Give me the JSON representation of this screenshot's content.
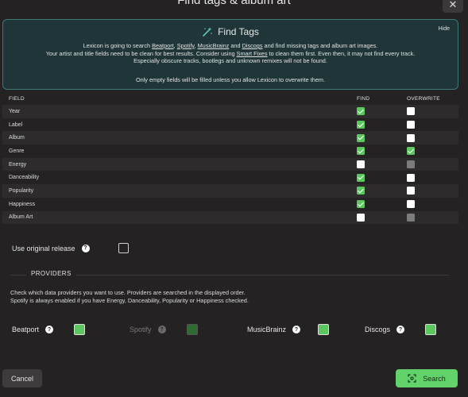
{
  "dialog": {
    "title": "Find tags & album art",
    "close_icon": "close-icon"
  },
  "info": {
    "title": "Find Tags",
    "hide_label": "Hide",
    "line1_a": "Lexicon is going to search ",
    "src_beatport": "Beatport",
    "sep1": ", ",
    "src_spotify": "Spotify",
    "sep2": ", ",
    "src_musicbrainz": "MusicBrainz",
    "sep3": " and ",
    "src_discogs": "Discogs",
    "line1_b": " and find missing tags and album art images.",
    "line2_a": "Your artist and title fields need to be clean for best results. Consider using ",
    "smart_fixes": "Smart Fixes",
    "line2_b": " to clean them first. Even then, it may not find every track.",
    "line3": "Especially obscure tracks, bootlegs and unknown remixes will not be found.",
    "note": "Only empty fields will be filled unless you allow Lexicon to overwrite them."
  },
  "table": {
    "headers": {
      "field": "FIELD",
      "find": "FIND",
      "overwrite": "OVERWRITE"
    },
    "rows": [
      {
        "field": "Year",
        "find": "checked",
        "overwrite": "unchecked"
      },
      {
        "field": "Label",
        "find": "checked",
        "overwrite": "unchecked"
      },
      {
        "field": "Album",
        "find": "checked",
        "overwrite": "unchecked"
      },
      {
        "field": "Genre",
        "find": "checked",
        "overwrite": "checked"
      },
      {
        "field": "Energy",
        "find": "unchecked",
        "overwrite": "disabled"
      },
      {
        "field": "Danceability",
        "find": "checked",
        "overwrite": "unchecked"
      },
      {
        "field": "Popularity",
        "find": "checked",
        "overwrite": "unchecked"
      },
      {
        "field": "Happiness",
        "find": "checked",
        "overwrite": "unchecked"
      },
      {
        "field": "Album Art",
        "find": "unchecked",
        "overwrite": "disabled"
      }
    ]
  },
  "original_release": {
    "label": "Use original release",
    "help": "?",
    "checked": false
  },
  "providers": {
    "title": "PROVIDERS",
    "desc1": "Check which data providers you want to use. Providers are searched in the displayed order.",
    "desc2": "Spotify is always enabled if you have Energy, Danceability, Popularity or Happiness checked.",
    "items": [
      {
        "name": "Beatport",
        "help": "?",
        "checked": true,
        "disabled": false
      },
      {
        "name": "Spotify",
        "help": "?",
        "checked": true,
        "disabled": true
      },
      {
        "name": "MusicBrainz",
        "help": "?",
        "checked": true,
        "disabled": false
      },
      {
        "name": "Discogs",
        "help": "?",
        "checked": true,
        "disabled": false
      }
    ]
  },
  "footer": {
    "cancel_label": "Cancel",
    "search_label": "Search"
  },
  "colors": {
    "accent": "#62d36a",
    "checkbox_green": "#5cc75e",
    "panel_bg": "#1f3538",
    "panel_border": "#3c7a78"
  }
}
